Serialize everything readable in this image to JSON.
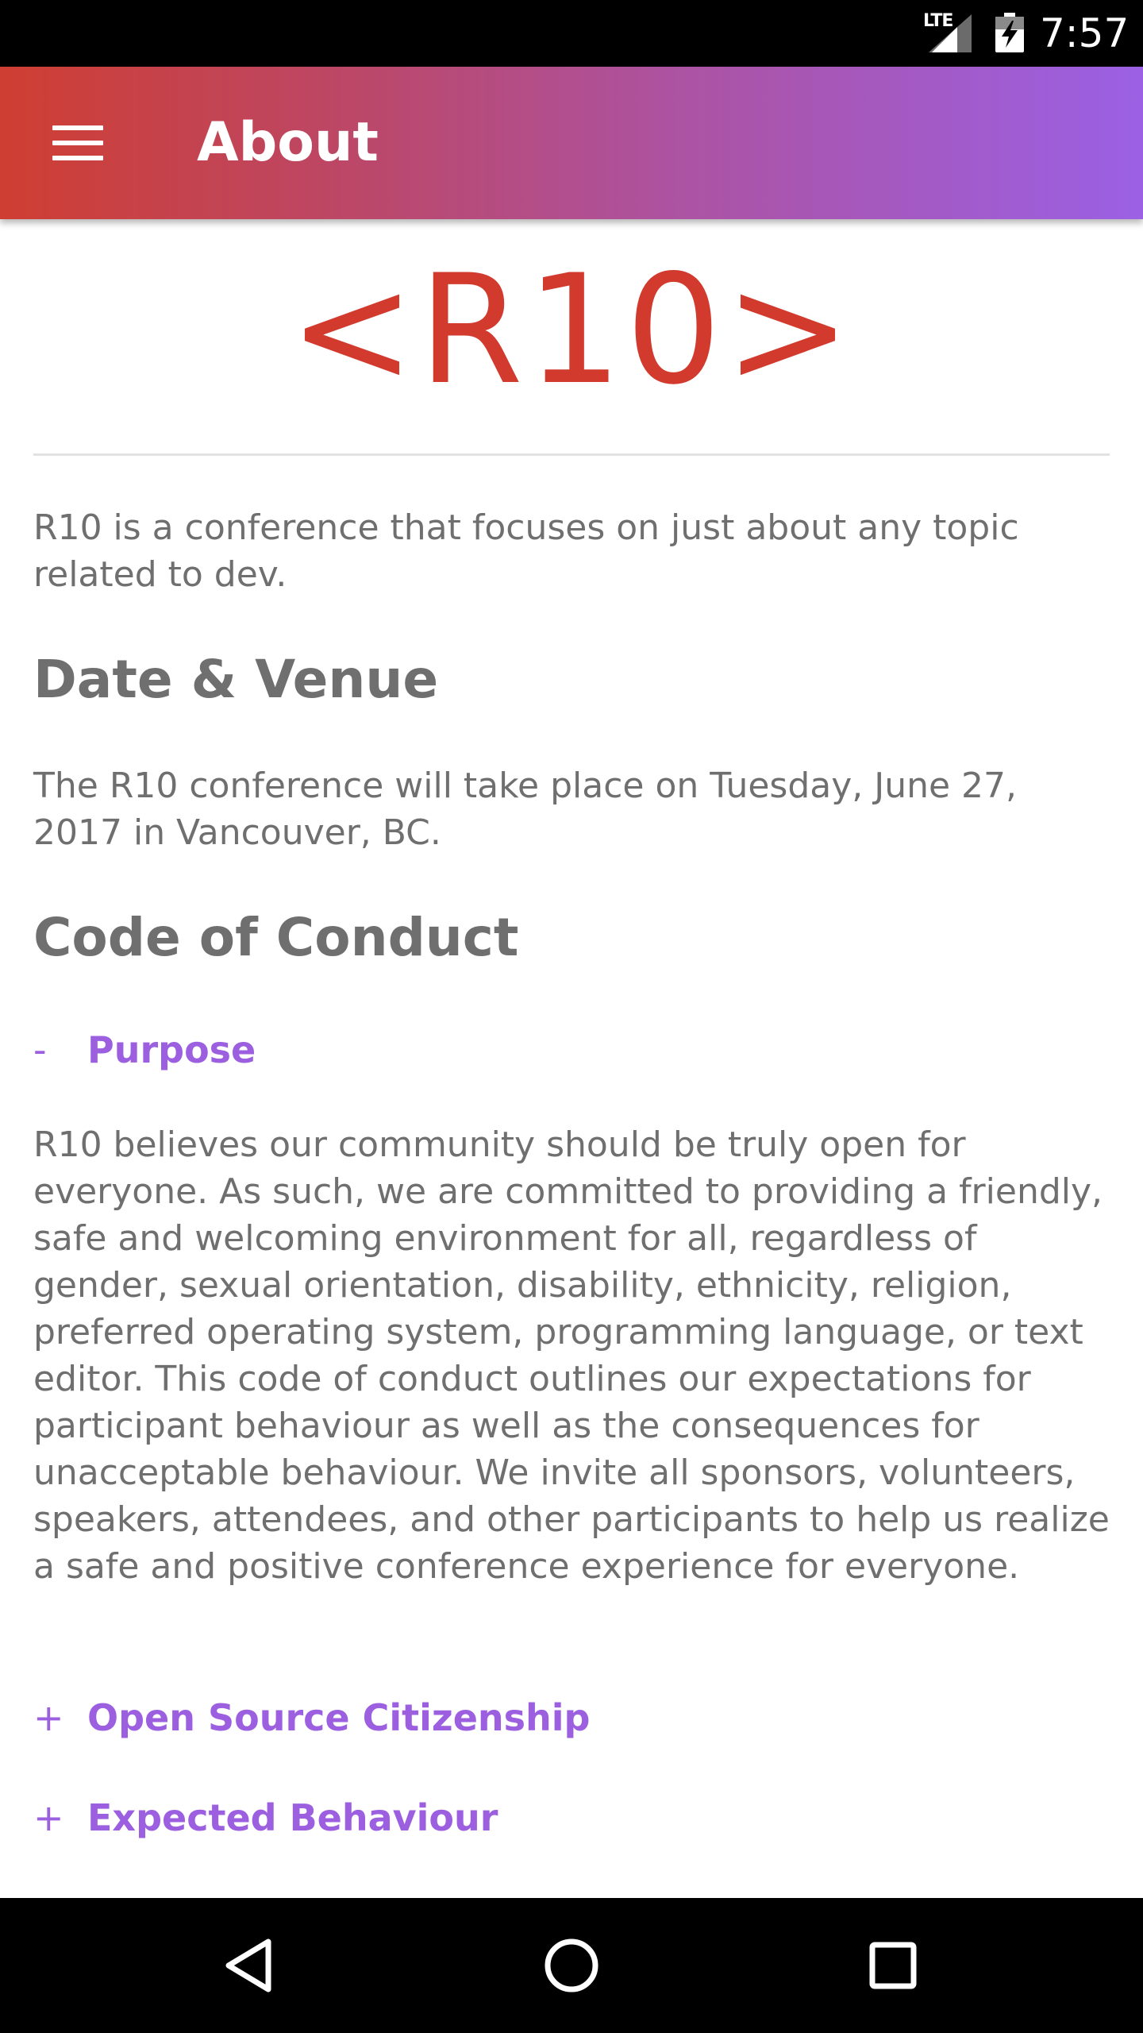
{
  "status_bar": {
    "network": "LTE",
    "time": "7:57"
  },
  "app_bar": {
    "menu_icon": "hamburger-menu-icon",
    "title": "About"
  },
  "logo": {
    "text": "<R10>",
    "color": "#d23a2d"
  },
  "intro": "R10 is a conference that focuses on just about any topic related to dev.",
  "date_venue": {
    "heading": "Date & Venue",
    "text": "The R10 conference will take place on Tuesday, June 27, 2017 in Vancouver, BC."
  },
  "code_of_conduct": {
    "heading": "Code of Conduct",
    "items": [
      {
        "toggle": "-",
        "title": "Purpose",
        "expanded": true,
        "body": "R10 believes our community should be truly open for everyone. As such, we are committed to providing a friendly, safe and welcoming environment for all, regardless of gender, sexual orientation, disability, ethnicity, religion, preferred operating system, programming language, or text editor. This code of conduct outlines our expectations for participant behaviour as well as the consequences for unacceptable behaviour. We invite all sponsors, volunteers, speakers, attendees, and other participants to help us realize a safe and positive conference experience for everyone."
      },
      {
        "toggle": "+",
        "title": "Open Source Citizenship",
        "expanded": false
      },
      {
        "toggle": "+",
        "title": "Expected Behaviour",
        "expanded": false
      }
    ]
  },
  "nav_bar": {
    "back_icon": "back-triangle-icon",
    "home_icon": "home-circle-icon",
    "recents_icon": "recents-square-icon"
  },
  "colors": {
    "accent": "#9b5fe0",
    "brand_red": "#d23a2d",
    "text_gray": "#6f6f6f"
  }
}
